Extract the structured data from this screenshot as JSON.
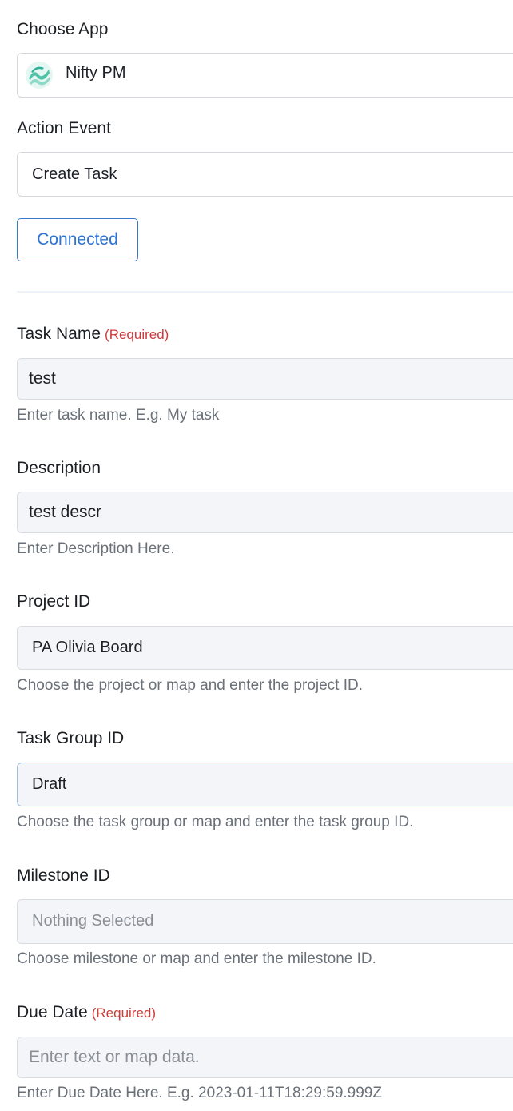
{
  "choose_app": {
    "label": "Choose App",
    "value": "Nifty PM",
    "icon": "nifty-pm-logo-icon"
  },
  "action_event": {
    "label": "Action Event",
    "value": "Create Task"
  },
  "connection": {
    "button_label": "Connected"
  },
  "fields": {
    "task_name": {
      "label": "Task Name",
      "required": "(Required)",
      "value": "test",
      "help": "Enter task name. E.g. My task"
    },
    "description": {
      "label": "Description",
      "value": "test descr",
      "help": "Enter Description Here."
    },
    "project_id": {
      "label": "Project ID",
      "value": "PA Olivia Board",
      "help": "Choose the project or map and enter the project ID."
    },
    "task_group_id": {
      "label": "Task Group ID",
      "value": "Draft",
      "help": "Choose the task group or map and enter the task group ID."
    },
    "milestone_id": {
      "label": "Milestone ID",
      "placeholder": "Nothing Selected",
      "help": "Choose milestone or map and enter the milestone ID."
    },
    "due_date": {
      "label": "Due Date",
      "required": "(Required)",
      "placeholder": "Enter text or map data.",
      "help": "Enter Due Date Here. E.g. 2023-01-11T18:29:59.999Z"
    }
  },
  "colors": {
    "accent": "#2e73d2",
    "required": "#cc3b3b",
    "field_bg": "#f3f5f8"
  }
}
